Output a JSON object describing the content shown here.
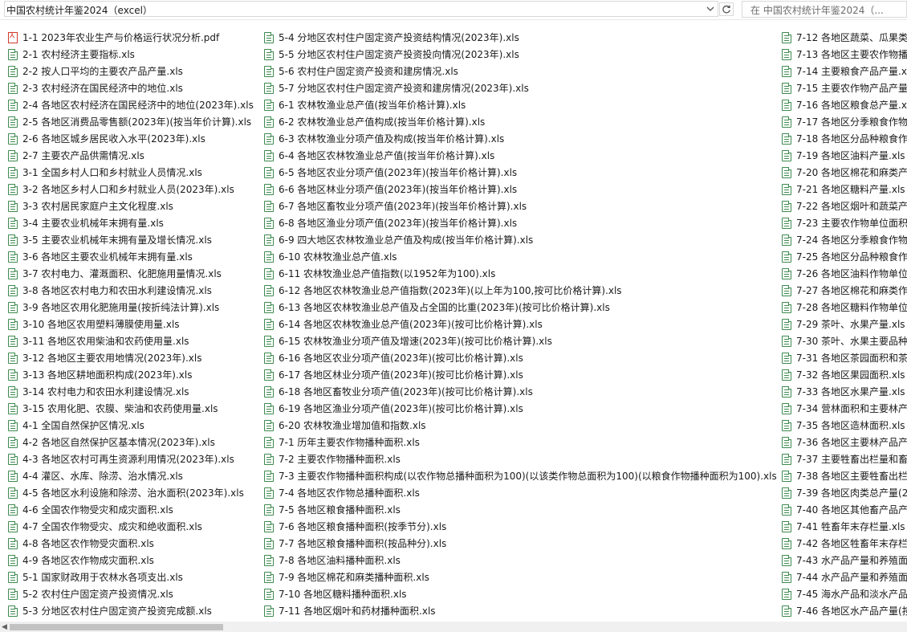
{
  "address": {
    "path": "中国农村统计年鉴2024（excel）",
    "search_placeholder": "在 中国农村统计年鉴2024（..."
  },
  "icons": {
    "dropdown": "chevron-down-icon",
    "refresh": "refresh-icon",
    "xls": "excel-file-icon",
    "pdf": "pdf-file-icon"
  },
  "columns": [
    [
      {
        "name": "1-1 2023年农业生产与价格运行状况分析.pdf",
        "type": "pdf"
      },
      {
        "name": "2-1 农村经济主要指标.xls",
        "type": "xls"
      },
      {
        "name": "2-2 按人口平均的主要农产品产量.xls",
        "type": "xls"
      },
      {
        "name": "2-3 农村经济在国民经济中的地位.xls",
        "type": "xls"
      },
      {
        "name": "2-4 各地区农村经济在国民经济中的地位(2023年).xls",
        "type": "xls"
      },
      {
        "name": "2-5 各地区消费品零售额(2023年)(按当年价计算).xls",
        "type": "xls"
      },
      {
        "name": "2-6 各地区城乡居民收入水平(2023年).xls",
        "type": "xls"
      },
      {
        "name": "2-7 主要农产品供需情况.xls",
        "type": "xls"
      },
      {
        "name": "3-1 全国乡村人口和乡村就业人员情况.xls",
        "type": "xls"
      },
      {
        "name": "3-2 各地区乡村人口和乡村就业人员(2023年).xls",
        "type": "xls"
      },
      {
        "name": "3-3 农村居民家庭户主文化程度.xls",
        "type": "xls"
      },
      {
        "name": "3-4 主要农业机械年末拥有量.xls",
        "type": "xls"
      },
      {
        "name": "3-5 主要农业机械年末拥有量及增长情况.xls",
        "type": "xls"
      },
      {
        "name": "3-6 各地区主要农业机械年末拥有量.xls",
        "type": "xls"
      },
      {
        "name": "3-7 农村电力、灌溉面积、化肥施用量情况.xls",
        "type": "xls"
      },
      {
        "name": "3-8 各地区农村电力和农田水利建设情况.xls",
        "type": "xls"
      },
      {
        "name": "3-9 各地区农用化肥施用量(按折纯法计算).xls",
        "type": "xls"
      },
      {
        "name": "3-10 各地区农用塑料薄膜使用量.xls",
        "type": "xls"
      },
      {
        "name": "3-11 各地区农用柴油和农药使用量.xls",
        "type": "xls"
      },
      {
        "name": "3-12 各地区主要农用地情况(2023年).xls",
        "type": "xls"
      },
      {
        "name": "3-13 各地区耕地面积构成(2023年).xls",
        "type": "xls"
      },
      {
        "name": "3-14 农村电力和农田水利建设情况.xls",
        "type": "xls"
      },
      {
        "name": "3-15 农用化肥、农膜、柴油和农药使用量.xls",
        "type": "xls"
      },
      {
        "name": "4-1 全国自然保护区情况.xls",
        "type": "xls"
      },
      {
        "name": "4-2 各地区自然保护区基本情况(2023年).xls",
        "type": "xls"
      },
      {
        "name": "4-3 各地区农村可再生资源利用情况(2023年).xls",
        "type": "xls"
      },
      {
        "name": "4-4 灌区、水库、除涝、治水情况.xls",
        "type": "xls"
      },
      {
        "name": "4-5 各地区水利设施和除涝、治水面积(2023年).xls",
        "type": "xls"
      },
      {
        "name": "4-6 全国农作物受灾和成灾面积.xls",
        "type": "xls"
      },
      {
        "name": "4-7 全国农作物受灾、成灾和绝收面积.xls",
        "type": "xls"
      },
      {
        "name": "4-8 各地区农作物受灾面积.xls",
        "type": "xls"
      },
      {
        "name": "4-9 各地区农作物成灾面积.xls",
        "type": "xls"
      },
      {
        "name": "5-1 国家财政用于农林水各项支出.xls",
        "type": "xls"
      },
      {
        "name": "5-2 农村住户固定资产投资情况.xls",
        "type": "xls"
      },
      {
        "name": "5-3 分地区农村住户固定资产投资完成额.xls",
        "type": "xls"
      }
    ],
    [
      {
        "name": "5-4 分地区农村住户固定资产投资结构情况(2023年).xls",
        "type": "xls"
      },
      {
        "name": "5-5 分地区农村住户固定资产投资投向情况(2023年).xls",
        "type": "xls"
      },
      {
        "name": "5-6 农村住户固定资产投资和建房情况.xls",
        "type": "xls"
      },
      {
        "name": "5-7 分地区农村住户固定资产投资和建房情况(2023年).xls",
        "type": "xls"
      },
      {
        "name": "6-1 农林牧渔业总产值(按当年价格计算).xls",
        "type": "xls"
      },
      {
        "name": "6-2 农林牧渔业总产值构成(按当年价格计算).xls",
        "type": "xls"
      },
      {
        "name": "6-3 农林牧渔业分项产值及构成(按当年价格计算).xls",
        "type": "xls"
      },
      {
        "name": "6-4 各地区农林牧渔业总产值(按当年价格计算).xls",
        "type": "xls"
      },
      {
        "name": "6-5 各地区农业分项产值(2023年)(按当年价格计算).xls",
        "type": "xls"
      },
      {
        "name": "6-6 各地区林业分项产值(2023年)(按当年价格计算).xls",
        "type": "xls"
      },
      {
        "name": "6-7 各地区畜牧业分项产值(2023年)(按当年价格计算).xls",
        "type": "xls"
      },
      {
        "name": "6-8 各地区渔业分项产值(2023年)(按当年价格计算).xls",
        "type": "xls"
      },
      {
        "name": "6-9 四大地区农林牧渔业总产值及构成(按当年价格计算).xls",
        "type": "xls"
      },
      {
        "name": "6-10 农林牧渔业总产值.xls",
        "type": "xls"
      },
      {
        "name": "6-11 农林牧渔业总产值指数(以1952年为100).xls",
        "type": "xls"
      },
      {
        "name": "6-12 各地区农林牧渔业总产值指数(2023年)(以上年为100,按可比价格计算).xls",
        "type": "xls"
      },
      {
        "name": "6-13 各地区农林牧渔业总产值及占全国的比重(2023年)(按可比价格计算).xls",
        "type": "xls"
      },
      {
        "name": "6-14 各地区农林牧渔业总产值(2023年)(按可比价格计算).xls",
        "type": "xls"
      },
      {
        "name": "6-15 农林牧渔业分项产值及增速(2023年)(按可比价格计算).xls",
        "type": "xls"
      },
      {
        "name": "6-16 各地区农业分项产值(2023年)(按可比价格计算).xls",
        "type": "xls"
      },
      {
        "name": "6-17 各地区林业分项产值(2023年)(按可比价格计算).xls",
        "type": "xls"
      },
      {
        "name": "6-18 各地区畜牧业分项产值(2023年)(按可比价格计算).xls",
        "type": "xls"
      },
      {
        "name": "6-19 各地区渔业分项产值(2023年)(按可比价格计算).xls",
        "type": "xls"
      },
      {
        "name": "6-20 农林牧渔业增加值和指数.xls",
        "type": "xls"
      },
      {
        "name": "7-1 历年主要农作物播种面积.xls",
        "type": "xls"
      },
      {
        "name": "7-2 主要农作物播种面积.xls",
        "type": "xls"
      },
      {
        "name": "7-3 主要农作物播种面积构成(以农作物总播种面积为100)(以该类作物总面积为100)(以粮食作物播种面积为100).xls",
        "type": "xls"
      },
      {
        "name": "7-4 各地区农作物总播种面积.xls",
        "type": "xls"
      },
      {
        "name": "7-5 各地区粮食播种面积.xls",
        "type": "xls"
      },
      {
        "name": "7-6 各地区粮食播种面积(按季节分).xls",
        "type": "xls"
      },
      {
        "name": "7-7 各地区粮食播种面积(按品种分).xls",
        "type": "xls"
      },
      {
        "name": "7-8 各地区油料播种面积.xls",
        "type": "xls"
      },
      {
        "name": "7-9 各地区棉花和麻类播种面积.xls",
        "type": "xls"
      },
      {
        "name": "7-10 各地区糖料播种面积.xls",
        "type": "xls"
      },
      {
        "name": "7-11 各地区烟叶和药材播种面积.xls",
        "type": "xls"
      }
    ],
    [
      {
        "name": "7-12 各地区蔬菜、瓜果类",
        "type": "xls"
      },
      {
        "name": "7-13 各地区主要农作物播",
        "type": "xls"
      },
      {
        "name": "7-14 主要粮食产品产量.x",
        "type": "xls"
      },
      {
        "name": "7-15 主要农作物产品产量",
        "type": "xls"
      },
      {
        "name": "7-16 各地区粮食总产量.x",
        "type": "xls"
      },
      {
        "name": "7-17 各地区分季粮食作物",
        "type": "xls"
      },
      {
        "name": "7-18 各地区分品种粮食作",
        "type": "xls"
      },
      {
        "name": "7-19 各地区油料产量.xls",
        "type": "xls"
      },
      {
        "name": "7-20 各地区棉花和麻类产",
        "type": "xls"
      },
      {
        "name": "7-21 各地区糖料产量.xls",
        "type": "xls"
      },
      {
        "name": "7-22 各地区烟叶和蔬菜产",
        "type": "xls"
      },
      {
        "name": "7-23 主要农作物单位面积",
        "type": "xls"
      },
      {
        "name": "7-24 各地区分季粮食作物",
        "type": "xls"
      },
      {
        "name": "7-25 各地区分品种粮食作",
        "type": "xls"
      },
      {
        "name": "7-26 各地区油料作物单位",
        "type": "xls"
      },
      {
        "name": "7-27 各地区棉花和麻类作",
        "type": "xls"
      },
      {
        "name": "7-28 各地区糖料作物单位",
        "type": "xls"
      },
      {
        "name": "7-29 茶叶、水果产量.xls",
        "type": "xls"
      },
      {
        "name": "7-30 茶叶、水果主要品种",
        "type": "xls"
      },
      {
        "name": "7-31 各地区茶园面积和茶",
        "type": "xls"
      },
      {
        "name": "7-32 各地区果园面积.xls",
        "type": "xls"
      },
      {
        "name": "7-33 各地区水果产量.xls",
        "type": "xls"
      },
      {
        "name": "7-34 营林面积和主要林产",
        "type": "xls"
      },
      {
        "name": "7-35 各地区造林面积.xls",
        "type": "xls"
      },
      {
        "name": "7-36 各地区主要林产品产",
        "type": "xls"
      },
      {
        "name": "7-37 主要牲畜出栏量和畜",
        "type": "xls"
      },
      {
        "name": "7-38 各地区主要牲畜出栏",
        "type": "xls"
      },
      {
        "name": "7-39 各地区肉类总产量(2",
        "type": "xls"
      },
      {
        "name": "7-40 各地区其他畜产品产",
        "type": "xls"
      },
      {
        "name": "7-41 牲畜年末存栏量.xls",
        "type": "xls"
      },
      {
        "name": "7-42 各地区牲畜年末存栏",
        "type": "xls"
      },
      {
        "name": "7-43 水产品产量和养殖面",
        "type": "xls"
      },
      {
        "name": "7-44 水产品产量和养殖面",
        "type": "xls"
      },
      {
        "name": "7-45 海水产品和淡水产品",
        "type": "xls"
      },
      {
        "name": "7-46 各地区水产品产量(按",
        "type": "xls"
      }
    ]
  ]
}
